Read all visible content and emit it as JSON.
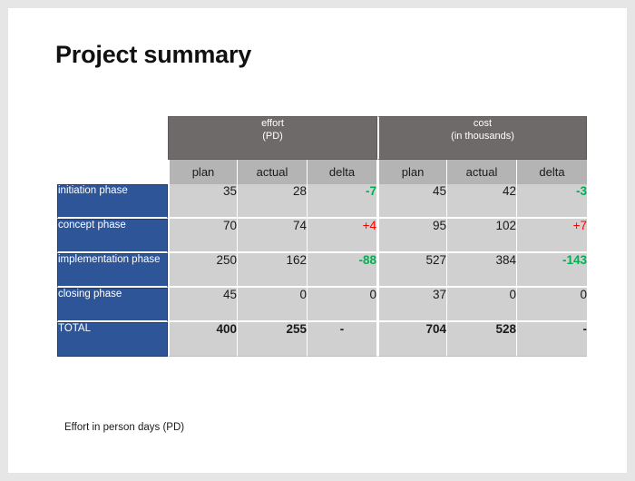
{
  "slide": {
    "title": "Project summary",
    "footnote": "Effort in person days (PD)"
  },
  "table": {
    "groups": [
      {
        "name": "effort",
        "unit": "(PD)"
      },
      {
        "name": "cost",
        "unit": "(in thousands)"
      }
    ],
    "subheaders": [
      "plan",
      "actual",
      "delta",
      "plan",
      "actual",
      "delta"
    ],
    "rows": [
      {
        "label": "initiation phase",
        "effort_plan": "35",
        "effort_actual": "28",
        "effort_delta": "-7",
        "cost_plan": "45",
        "cost_actual": "42",
        "cost_delta": "-3"
      },
      {
        "label": "concept phase",
        "effort_plan": "70",
        "effort_actual": "74",
        "effort_delta": "+4",
        "cost_plan": "95",
        "cost_actual": "102",
        "cost_delta": "+7"
      },
      {
        "label": "implementation phase",
        "effort_plan": "250",
        "effort_actual": "162",
        "effort_delta": "-88",
        "cost_plan": "527",
        "cost_actual": "384",
        "cost_delta": "-143"
      },
      {
        "label": "closing phase",
        "effort_plan": "45",
        "effort_actual": "0",
        "effort_delta": "0",
        "cost_plan": "37",
        "cost_actual": "0",
        "cost_delta": "0"
      },
      {
        "label": "TOTAL",
        "effort_plan": "400",
        "effort_actual": "255",
        "effort_delta": "-",
        "cost_plan": "704",
        "cost_actual": "528",
        "cost_delta": "-"
      }
    ]
  },
  "colors": {
    "header_gray": "#6e6a6a",
    "subheader_gray": "#b4b4b4",
    "cell_gray": "#d0d0d0",
    "label_blue": "#2e5597",
    "delta_negative_green": "#00b050",
    "delta_positive_red": "#ff0000"
  }
}
